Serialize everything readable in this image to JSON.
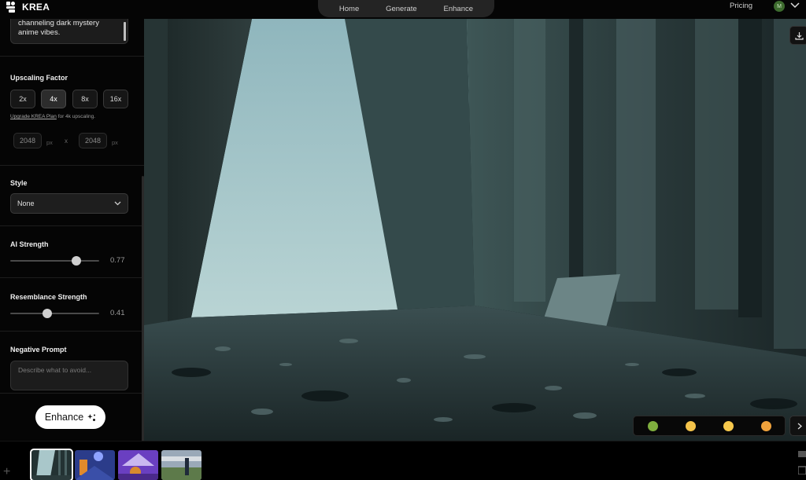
{
  "header": {
    "logo_text": "KREA",
    "nav": [
      "Home",
      "Generate",
      "Enhance"
    ],
    "pricing": "Pricing",
    "avatar_initial": "M"
  },
  "sidebar": {
    "prompt_text": "channeling dark mystery anime vibes.",
    "upscaling": {
      "label": "Upscaling Factor",
      "options": [
        "2x",
        "4x",
        "8x",
        "16x"
      ],
      "selected": "4x",
      "upgrade_link": "Upgrade KREA Plan",
      "upgrade_rest": " for 4k upscaling.",
      "width": "2048",
      "height": "2048",
      "unit": "px",
      "separator": "x"
    },
    "style": {
      "label": "Style",
      "value": "None"
    },
    "ai_strength": {
      "label": "AI Strength",
      "value": "0.77"
    },
    "resemblance": {
      "label": "Resemblance Strength",
      "value": "0.41"
    },
    "negative_prompt": {
      "label": "Negative Prompt",
      "placeholder": "Describe what to avoid..."
    },
    "enhance_button": "Enhance"
  },
  "feedback": {
    "emojis": [
      "nauseated-face-icon",
      "pensive-face-icon",
      "grinning-face-icon",
      "heart-eyes-face-icon"
    ]
  },
  "colors": {
    "accent": "#ffffff",
    "panel": "#050505",
    "avatar": "#3d6b2e"
  }
}
